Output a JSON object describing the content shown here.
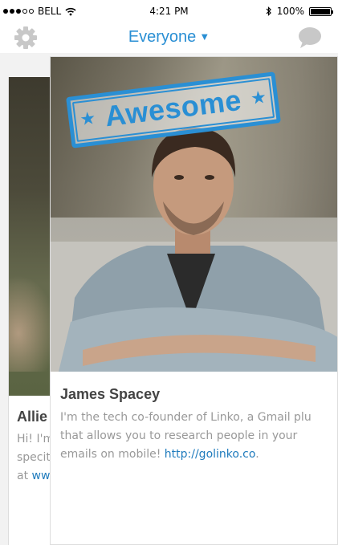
{
  "status_bar": {
    "carrier": "BELL",
    "time": "4:21 PM",
    "battery": "100%",
    "signal_bars_filled": 3,
    "signal_bars_total": 5,
    "battery_level": 1.0
  },
  "navbar": {
    "title": "Everyone",
    "caret": "▼",
    "left_icon": "gear-icon",
    "right_icon": "chat-bubble-icon"
  },
  "cards": {
    "front": {
      "name": "James Spacey",
      "bio_line1": "I'm the tech co-founder of Linko, a Gmail plu",
      "bio_line2": "that allows you to research people in your",
      "bio_line3_text": "emails on mobile! ",
      "bio_link": "http://golinko.co",
      "bio_line3_end": ".",
      "stamp": "Awesome",
      "stamp_star": "★"
    },
    "back": {
      "name": "Allie",
      "bio_line1": "Hi! I'm",
      "bio_line2": "specit",
      "bio_line3_text": "at ",
      "bio_link": "ww"
    }
  },
  "colors": {
    "accent": "#2a8fd4",
    "link": "#1f7bbd",
    "icon_gray": "#c8c8c8",
    "background": "#f2f2f2"
  }
}
